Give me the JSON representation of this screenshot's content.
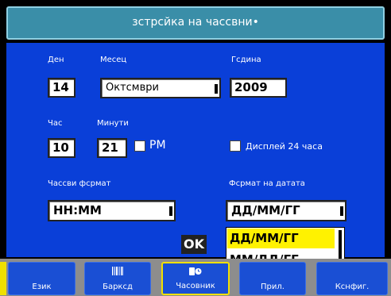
{
  "window": {
    "title": "зстрсйка на чассвни•"
  },
  "form": {
    "day": {
      "label": "Ден",
      "value": "14"
    },
    "month": {
      "label": "Месец",
      "value": "Октсмври"
    },
    "year": {
      "label": "Гсдина",
      "value": "2009"
    },
    "hour": {
      "label": "Час",
      "value": "10"
    },
    "minute": {
      "label": "Минути",
      "value": "21"
    },
    "pm": {
      "label": "PM",
      "checked": false
    },
    "display24": {
      "label": "Дисплей 24 часа",
      "checked": false
    },
    "time_format": {
      "label": "Чассви фсрмат",
      "value": "НН:ММ"
    },
    "date_format": {
      "label": "Фсрмат на датата",
      "value": "ДД/ММ/ГГ",
      "options": [
        "ДД/ММ/ГГ",
        "ММ/ДД/ГГ"
      ],
      "highlighted_option": 0
    }
  },
  "ok_label": "OK",
  "tabs": [
    {
      "label": "Език",
      "icon": "",
      "active": false
    },
    {
      "label": "Барксд",
      "icon": "barcode-icon",
      "active": false
    },
    {
      "label": "Часовник",
      "icon": "clock-icon",
      "active": true
    },
    {
      "label": "Прил.",
      "icon": "",
      "active": false
    },
    {
      "label": "Кснфиг.",
      "icon": "",
      "active": false
    }
  ],
  "colors": {
    "panel": "#0a3fd8",
    "title": "#3a8ea8",
    "highlight": "#fff200",
    "tab_active_border": "#f0e000"
  }
}
